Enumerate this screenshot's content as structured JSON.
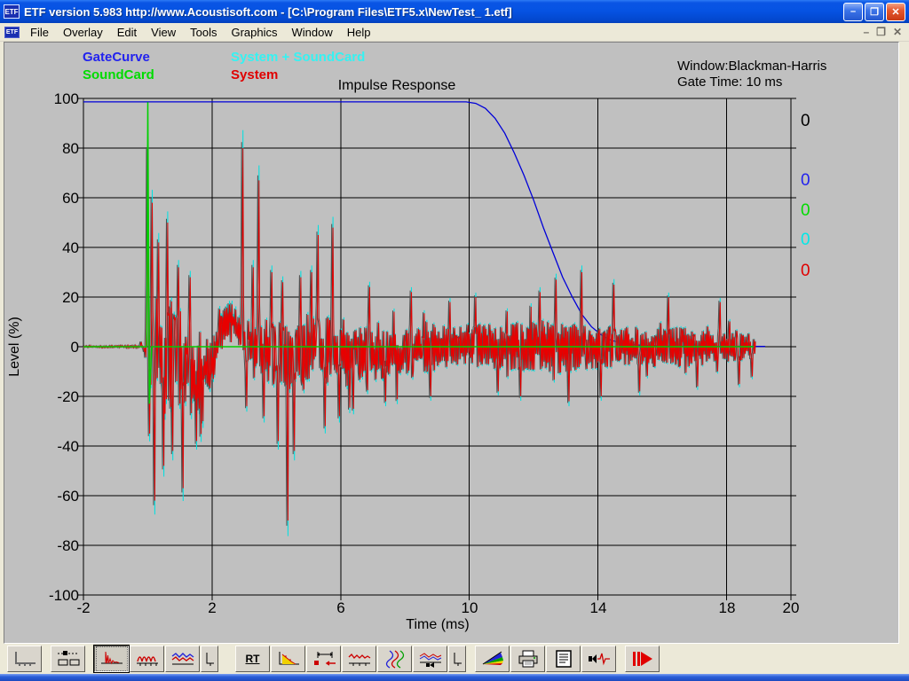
{
  "window": {
    "title": "ETF version 5.983 http://www.Acoustisoft.com - [C:\\Program Files\\ETF5.x\\NewTest_ 1.etf]",
    "icon_text": "ETF",
    "controls": {
      "minimize": "–",
      "restore": "❐",
      "close": "✕"
    }
  },
  "menu": {
    "items": [
      "File",
      "Overlay",
      "Edit",
      "View",
      "Tools",
      "Graphics",
      "Window",
      "Help"
    ],
    "mdi": {
      "minimize": "–",
      "restore": "❐",
      "close": "✕"
    }
  },
  "chart": {
    "legend": [
      {
        "label": "GateCurve",
        "color": "#2222ee"
      },
      {
        "label": "SoundCard",
        "color": "#00dc00"
      },
      {
        "label": "System + SoundCard",
        "color": "#35f2f2"
      },
      {
        "label": "System",
        "color": "#e00000"
      }
    ],
    "info_line1": "Window:Blackman-Harris",
    "info_line2": "Gate Time: 10 ms",
    "title": "Impulse Response",
    "ylabel": "Level (%)",
    "xlabel": "Time (ms)",
    "y_ticks": [
      "100",
      "80",
      "60",
      "40",
      "20",
      "0",
      "-20",
      "-40",
      "-60",
      "-80",
      "-100"
    ],
    "x_ticks": [
      "-2",
      "2",
      "6",
      "10",
      "14",
      "18",
      "20"
    ],
    "offset_markers": [
      {
        "label": "0",
        "color": "#000000"
      },
      {
        "label": "0",
        "color": "#2222ee"
      },
      {
        "label": "0",
        "color": "#00dc00"
      },
      {
        "label": "0",
        "color": "#00e8e8"
      },
      {
        "label": "0",
        "color": "#e00000"
      }
    ]
  },
  "chart_data": {
    "type": "line",
    "title": "Impulse Response",
    "xlabel": "Time (ms)",
    "ylabel": "Level (%)",
    "xlim": [
      -2,
      20
    ],
    "ylim": [
      -100,
      100
    ],
    "x_grid": [
      -2,
      2,
      6,
      10,
      14,
      18
    ],
    "x_tick_vals": [
      -2,
      2,
      6,
      10,
      14,
      18,
      20
    ],
    "y_grid_step": 20,
    "grid": true,
    "series": [
      {
        "name": "GateCurve",
        "color": "#0000d8",
        "breakpoints": [
          [
            -2,
            98.6
          ],
          [
            9.9,
            98.6
          ],
          [
            10.2,
            98
          ],
          [
            10.5,
            96
          ],
          [
            10.8,
            92
          ],
          [
            11.1,
            86
          ],
          [
            11.4,
            78
          ],
          [
            11.7,
            69
          ],
          [
            12,
            59
          ],
          [
            12.3,
            48
          ],
          [
            12.6,
            38
          ],
          [
            12.9,
            28
          ],
          [
            13.2,
            20
          ],
          [
            13.5,
            13
          ],
          [
            13.8,
            8
          ],
          [
            14.1,
            4.8
          ],
          [
            14.4,
            2.6
          ],
          [
            14.8,
            1.3
          ],
          [
            15.4,
            0.5
          ],
          [
            16.2,
            0.2
          ],
          [
            19.2,
            0.1
          ]
        ]
      },
      {
        "name": "System + SoundCard",
        "color": "#00e0e0",
        "scale": 1.09
      },
      {
        "name": "System shadow",
        "color": "#4f4f4f",
        "scale": 1.03
      },
      {
        "name": "System",
        "color": "#e80000",
        "scale": 1.0
      },
      {
        "name": "SoundCard",
        "color": "#00d000",
        "points": [
          [
            -2,
            0
          ],
          [
            -0.03,
            0
          ],
          [
            0,
            98.5
          ],
          [
            0.05,
            -23
          ],
          [
            0.12,
            0
          ],
          [
            18.85,
            0
          ]
        ]
      }
    ],
    "noise": {
      "seed": 1337,
      "dt": 0.02,
      "t_start": -2,
      "t_end": 18.9,
      "mean": [
        [
          -2,
          0
        ],
        [
          0,
          0
        ],
        [
          0.5,
          -3
        ],
        [
          1.4,
          -10
        ],
        [
          2,
          -8
        ],
        [
          2.3,
          6
        ],
        [
          2.6,
          12
        ],
        [
          2.9,
          5
        ],
        [
          3.1,
          0
        ],
        [
          4.6,
          -5
        ],
        [
          5.2,
          0
        ],
        [
          6.5,
          -4
        ],
        [
          8,
          -3
        ],
        [
          9,
          0
        ],
        [
          18.9,
          0
        ]
      ],
      "amp": [
        [
          -2,
          0.4
        ],
        [
          -0.08,
          0.6
        ],
        [
          0.05,
          30
        ],
        [
          0.6,
          25
        ],
        [
          1.5,
          18
        ],
        [
          2.2,
          8
        ],
        [
          2.9,
          6
        ],
        [
          3.1,
          12
        ],
        [
          4,
          14
        ],
        [
          5,
          12
        ],
        [
          6,
          14
        ],
        [
          7,
          11
        ],
        [
          8,
          10
        ],
        [
          9.5,
          9
        ],
        [
          11,
          9
        ],
        [
          12.5,
          11
        ],
        [
          13.5,
          10
        ],
        [
          15,
          8
        ],
        [
          17,
          8
        ],
        [
          18.9,
          6
        ]
      ],
      "peaks": [
        [
          -0.2,
          2
        ],
        [
          -0.1,
          -2
        ],
        [
          0,
          78
        ],
        [
          0.07,
          -35
        ],
        [
          0.14,
          58
        ],
        [
          0.22,
          -62
        ],
        [
          0.33,
          42
        ],
        [
          0.5,
          -48
        ],
        [
          0.62,
          50
        ],
        [
          0.78,
          -42
        ],
        [
          0.95,
          32
        ],
        [
          1.1,
          -57
        ],
        [
          1.32,
          28
        ],
        [
          1.52,
          -38
        ],
        [
          1.72,
          -30
        ],
        [
          2.95,
          80
        ],
        [
          3.08,
          -24
        ],
        [
          3.28,
          32
        ],
        [
          3.45,
          67
        ],
        [
          3.62,
          -28
        ],
        [
          3.85,
          30
        ],
        [
          4.05,
          -38
        ],
        [
          4.2,
          26
        ],
        [
          4.35,
          -70
        ],
        [
          4.55,
          -42
        ],
        [
          4.75,
          28
        ],
        [
          5.1,
          30
        ],
        [
          5.3,
          45
        ],
        [
          5.52,
          -32
        ],
        [
          5.75,
          48
        ],
        [
          5.95,
          -28
        ],
        [
          6.4,
          -25
        ],
        [
          6.9,
          24
        ],
        [
          7.4,
          -22
        ],
        [
          8.2,
          22
        ],
        [
          8.8,
          -20
        ],
        [
          9.4,
          18
        ],
        [
          10.2,
          20
        ],
        [
          10.9,
          -18
        ],
        [
          11.6,
          -20
        ],
        [
          12.2,
          22
        ],
        [
          12.7,
          27
        ],
        [
          13.1,
          -22
        ],
        [
          13.5,
          30
        ],
        [
          14.1,
          -20
        ],
        [
          14.5,
          25
        ],
        [
          15.3,
          -18
        ],
        [
          16.2,
          20
        ],
        [
          17.1,
          -16
        ],
        [
          17.8,
          18
        ],
        [
          18.4,
          -15
        ],
        [
          18.8,
          -12
        ]
      ]
    }
  },
  "toolbar": {
    "buttons": [
      {
        "name": "graph-axis"
      },
      {
        "name": "panels-settings"
      },
      {
        "name": "impulse-response",
        "pressed": true
      },
      {
        "name": "frequency-sines"
      },
      {
        "name": "overlay-curves"
      },
      {
        "name": "small-axis-a"
      },
      {
        "name": "rt60",
        "text": "RT"
      },
      {
        "name": "energy-decay"
      },
      {
        "name": "gate-markers"
      },
      {
        "name": "wavy-response"
      },
      {
        "name": "rgb-sines"
      },
      {
        "name": "speaker-graph"
      },
      {
        "name": "small-axis-b"
      },
      {
        "name": "waterfall-wedge"
      },
      {
        "name": "print"
      },
      {
        "name": "notes-document"
      },
      {
        "name": "speaker-pulse"
      },
      {
        "name": "measure-run"
      }
    ]
  }
}
